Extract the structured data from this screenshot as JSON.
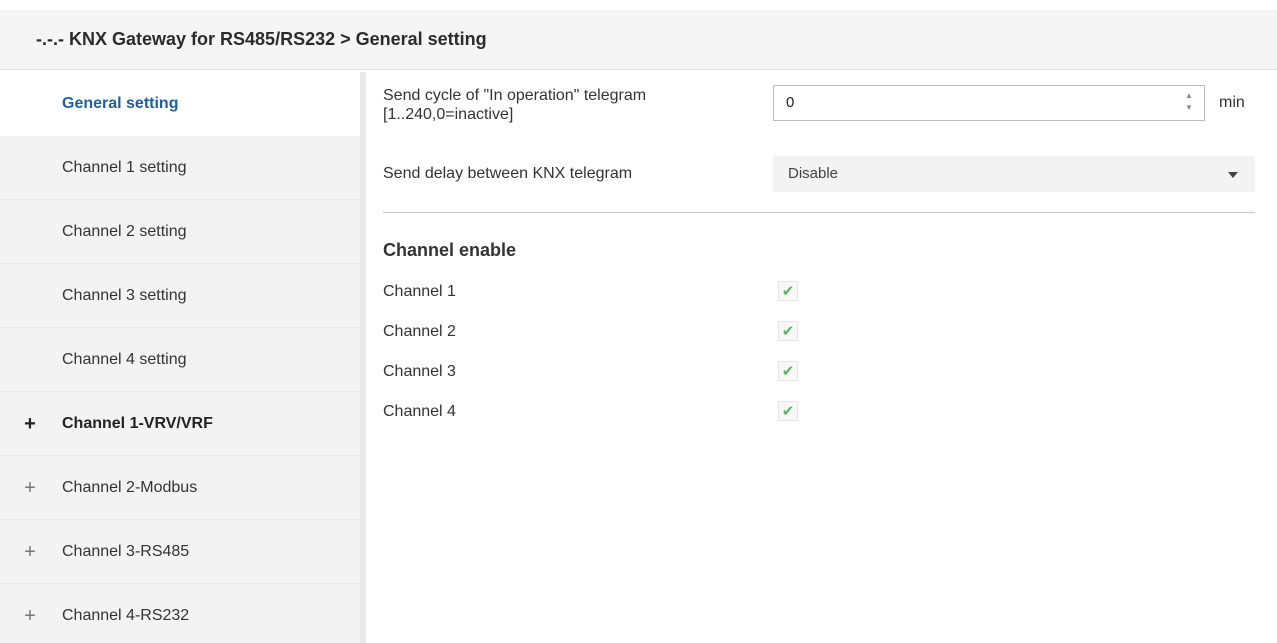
{
  "header": {
    "title": "-.-.- KNX Gateway for RS485/RS232 > General setting"
  },
  "sidebar": {
    "items": [
      {
        "label": "General setting",
        "expand": ""
      },
      {
        "label": "Channel 1 setting",
        "expand": ""
      },
      {
        "label": "Channel 2 setting",
        "expand": ""
      },
      {
        "label": "Channel 3 setting",
        "expand": ""
      },
      {
        "label": "Channel 4 setting",
        "expand": ""
      },
      {
        "label": "Channel 1-VRV/VRF",
        "expand": "+"
      },
      {
        "label": "Channel 2-Modbus",
        "expand": "+"
      },
      {
        "label": "Channel 3-RS485",
        "expand": "+"
      },
      {
        "label": "Channel 4-RS232",
        "expand": "+"
      }
    ]
  },
  "main": {
    "send_cycle": {
      "label_line1": "Send cycle of  \"In operation\" telegram",
      "label_line2": "[1..240,0=inactive]",
      "value": "0",
      "unit": "min"
    },
    "send_delay": {
      "label": "Send delay between KNX telegram",
      "value": "Disable"
    },
    "channel_enable": {
      "title": "Channel enable",
      "channels": [
        {
          "label": "Channel 1",
          "checked": true
        },
        {
          "label": "Channel 2",
          "checked": true
        },
        {
          "label": "Channel 3",
          "checked": true
        },
        {
          "label": "Channel 4",
          "checked": true
        }
      ]
    }
  },
  "colors": {
    "active_text": "#1f5fa0",
    "check": "#5cb85c"
  },
  "icons": {
    "expand": "plus-icon",
    "check": "checkmark-icon",
    "spin": "spin-arrows-icon",
    "caret": "caret-down-icon"
  }
}
